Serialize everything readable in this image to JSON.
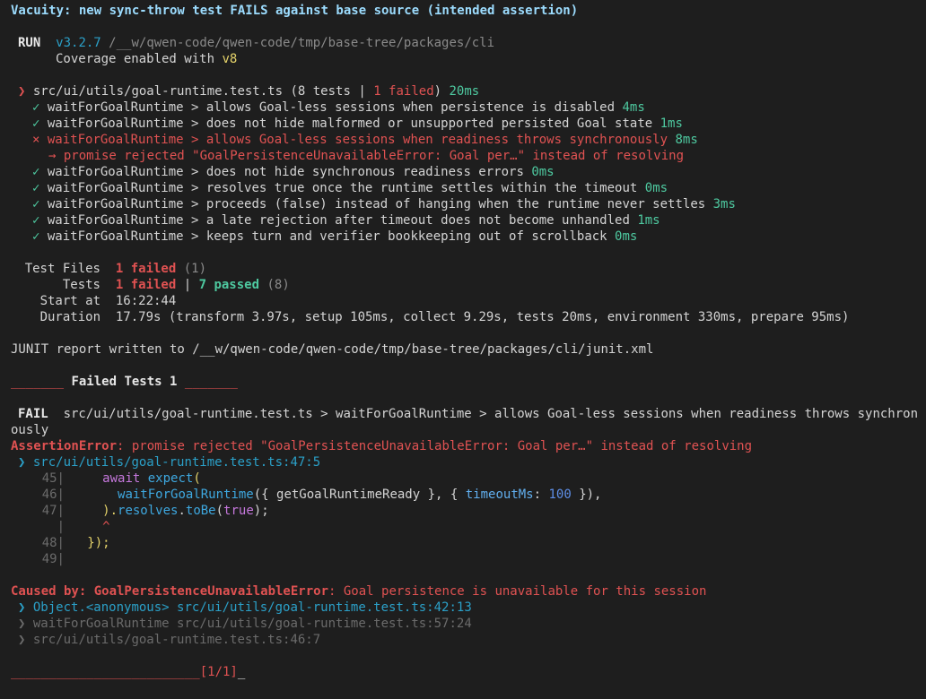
{
  "heading": "Vacuity: new sync-throw test FAILS against base source (intended assertion)",
  "run": {
    "label": "RUN",
    "version": "v3.2.7",
    "path": "/__w/qwen-code/qwen-code/tmp/base-tree/packages/cli",
    "coverage_prefix": "Coverage enabled with ",
    "coverage_tool": "v8"
  },
  "suite": {
    "marker": "❯",
    "file": "src/ui/utils/goal-runtime.test.ts",
    "summary_open": "(8 tests | ",
    "summary_failed": "1 failed",
    "summary_close": ")",
    "duration": "20ms"
  },
  "tests": [
    {
      "mark": "✓",
      "name": "waitForGoalRuntime > allows Goal-less sessions when persistence is disabled",
      "time": "4ms"
    },
    {
      "mark": "✓",
      "name": "waitForGoalRuntime > does not hide malformed or unsupported persisted Goal state",
      "time": "1ms"
    },
    {
      "mark": "×",
      "name": "waitForGoalRuntime > allows Goal-less sessions when readiness throws synchronously",
      "time": "8ms"
    },
    {
      "mark": "✓",
      "name": "waitForGoalRuntime > does not hide synchronous readiness errors",
      "time": "0ms"
    },
    {
      "mark": "✓",
      "name": "waitForGoalRuntime > resolves true once the runtime settles within the timeout",
      "time": "0ms"
    },
    {
      "mark": "✓",
      "name": "waitForGoalRuntime > proceeds (false) instead of hanging when the runtime never settles",
      "time": "3ms"
    },
    {
      "mark": "✓",
      "name": "waitForGoalRuntime > a late rejection after timeout does not become unhandled",
      "time": "1ms"
    },
    {
      "mark": "✓",
      "name": "waitForGoalRuntime > keeps turn and verifier bookkeeping out of scrollback",
      "time": "0ms"
    }
  ],
  "failure_detail": "→ promise rejected \"GoalPersistenceUnavailableError: Goal per…\" instead of resolving",
  "summary": {
    "files_label": "Test Files",
    "files_failed": "1 failed",
    "files_total": "(1)",
    "tests_label": "Tests",
    "tests_failed": "1 failed",
    "tests_sep": " | ",
    "tests_passed": "7 passed",
    "tests_total": "(8)",
    "start_label": "Start at",
    "start_value": "16:22:44",
    "duration_label": "Duration",
    "duration_value": "17.79s (transform 3.97s, setup 105ms, collect 9.29s, tests 20ms, environment 330ms, prepare 95ms)"
  },
  "junit": "JUNIT report written to /__w/qwen-code/qwen-code/tmp/base-tree/packages/cli/junit.xml",
  "failed_header": {
    "left_bar": "_______",
    "title": "Failed Tests 1",
    "right_bar": "_______"
  },
  "fail": {
    "label": "FAIL",
    "path": "src/ui/utils/goal-runtime.test.ts > waitForGoalRuntime > allows Goal-less sessions when readiness throws synchron",
    "path_wrap": "ously",
    "error_name": "AssertionError",
    "error_message": ": promise rejected \"GoalPersistenceUnavailableError: Goal per…\" instead of resolving",
    "location_marker": "❯",
    "location": "src/ui/utils/goal-runtime.test.ts:47:5"
  },
  "code": {
    "l45": "45|",
    "l46": "46|",
    "l47": "47|",
    "lbar": "|",
    "l48": "48|",
    "l49": "49|",
    "await": "await",
    "expect": "expect",
    "paren_open": "(",
    "waitfn": "waitForGoalRuntime",
    "args_open": "({ getGoalRuntimeReady }, { ",
    "timeout_key": "timeoutMs",
    "colon": ": ",
    "timeout_val": "100",
    "args_close": " }),",
    "close_paren": ").",
    "resolves": "resolves",
    "dot": ".",
    "tobe": "toBe",
    "p_open": "(",
    "true_val": "true",
    "p_close": ");",
    "caret": "^",
    "closing": "});"
  },
  "caused": {
    "label": "Caused by: ",
    "error_name": "GoalPersistenceUnavailableError",
    "message": ": Goal persistence is unavailable for this session",
    "stack": [
      {
        "marker": "❯",
        "fn": "Object.<anonymous>",
        "loc": "src/ui/utils/goal-runtime.test.ts:42:13"
      },
      {
        "marker": "❯",
        "fn": "waitForGoalRuntime",
        "loc": "src/ui/utils/goal-runtime.test.ts:57:24"
      },
      {
        "marker": "❯",
        "fn": "",
        "loc": "src/ui/utils/goal-runtime.test.ts:46:7"
      }
    ]
  },
  "footer": {
    "bar": "_________________________",
    "counter": "[1/1]",
    "tail": "_"
  }
}
